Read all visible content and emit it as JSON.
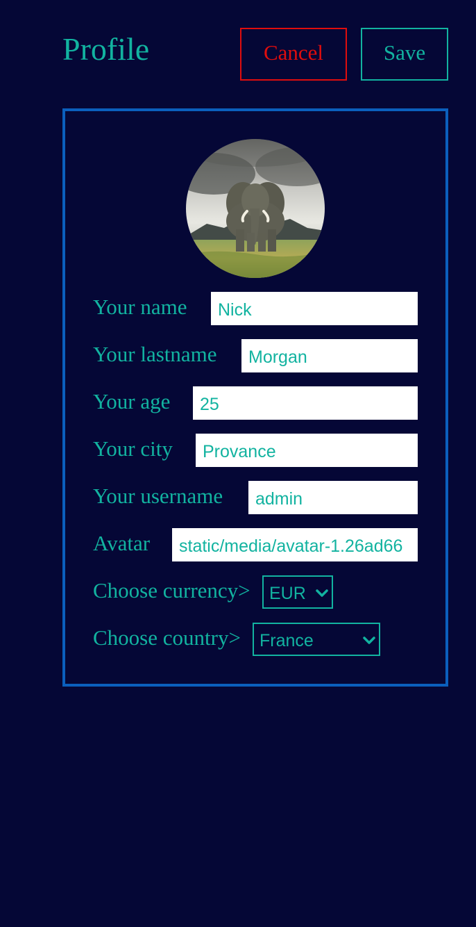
{
  "header": {
    "title": "Profile",
    "cancel_label": "Cancel",
    "save_label": "Save"
  },
  "form": {
    "name": {
      "label": "Your name",
      "value": "Nick"
    },
    "lastname": {
      "label": "Your lastname",
      "value": "Morgan"
    },
    "age": {
      "label": "Your age",
      "value": "25"
    },
    "city": {
      "label": "Your city",
      "value": "Provance"
    },
    "username": {
      "label": "Your username",
      "value": "admin"
    },
    "avatar": {
      "label": "Avatar",
      "value": "static/media/avatar-1.26ad66"
    },
    "currency": {
      "label": "Choose currency>",
      "selected": "EUR"
    },
    "country": {
      "label": "Choose country>",
      "selected": "France"
    }
  },
  "avatar_image": "elephant-avatar-photo",
  "icons": {
    "select_arrow": "chevron-down-icon"
  },
  "colors": {
    "background": "#050736",
    "accent": "#12b3a0",
    "danger": "#e00d0d",
    "card_border": "#0b5fbd",
    "field_bg": "#ffffff"
  }
}
